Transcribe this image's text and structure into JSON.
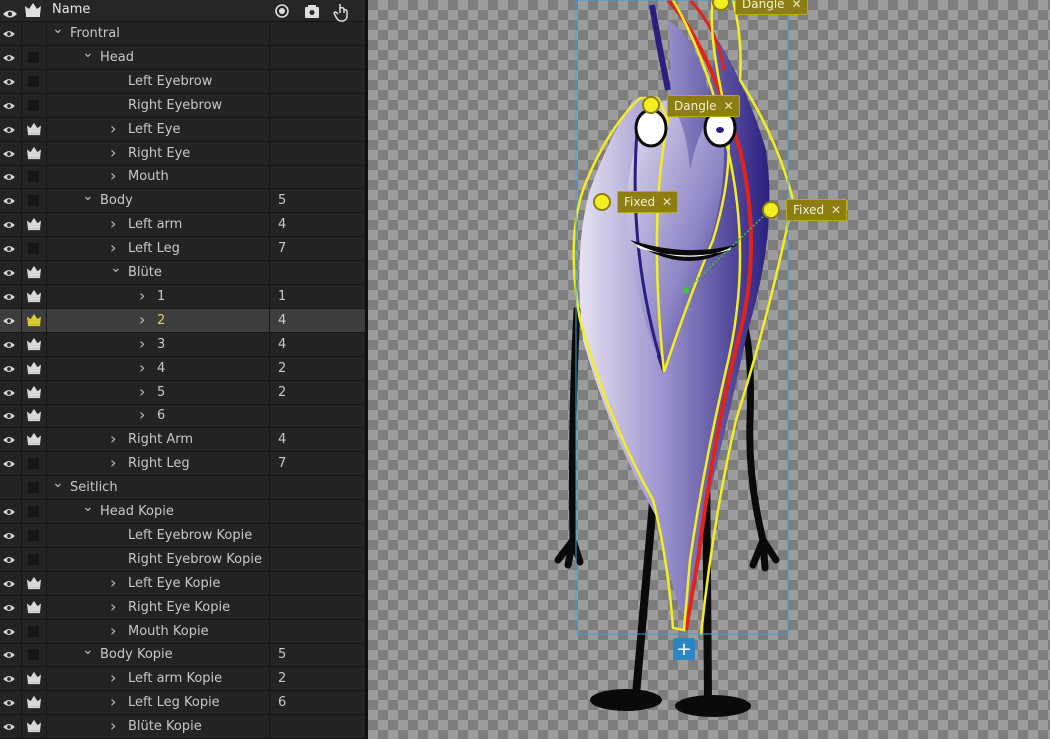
{
  "header": {
    "name_label": "Name",
    "eye_icon": "eye-icon",
    "crown_icon": "crown-icon",
    "record_icon": "record-icon",
    "camera_icon": "camera-icon",
    "hand_icon": "hand-pointer-icon"
  },
  "rows": [
    {
      "label": "Frontral",
      "depth": 0,
      "chevron": "down",
      "eye": true,
      "crown": "none",
      "num": ""
    },
    {
      "label": "Head",
      "depth": 1,
      "chevron": "down",
      "eye": true,
      "crown": "box",
      "num": ""
    },
    {
      "label": "Left Eyebrow",
      "depth": 2,
      "chevron": "",
      "eye": true,
      "crown": "box",
      "num": ""
    },
    {
      "label": "Right Eyebrow",
      "depth": 2,
      "chevron": "",
      "eye": true,
      "crown": "box",
      "num": ""
    },
    {
      "label": "Left Eye",
      "depth": 2,
      "chevron": "right",
      "eye": true,
      "crown": "crown",
      "num": ""
    },
    {
      "label": "Right Eye",
      "depth": 2,
      "chevron": "right",
      "eye": true,
      "crown": "crown",
      "num": ""
    },
    {
      "label": "Mouth",
      "depth": 2,
      "chevron": "right",
      "eye": true,
      "crown": "box",
      "num": ""
    },
    {
      "label": "Body",
      "depth": 1,
      "chevron": "down",
      "eye": true,
      "crown": "box",
      "num": "5"
    },
    {
      "label": "Left arm",
      "depth": 2,
      "chevron": "right",
      "eye": true,
      "crown": "crown",
      "num": "4"
    },
    {
      "label": "Left Leg",
      "depth": 2,
      "chevron": "right",
      "eye": true,
      "crown": "box",
      "num": "7"
    },
    {
      "label": "Blüte",
      "depth": 2,
      "chevron": "down",
      "eye": true,
      "crown": "crown",
      "num": ""
    },
    {
      "label": "1",
      "depth": 3,
      "chevron": "right",
      "eye": true,
      "crown": "crown",
      "num": "1"
    },
    {
      "label": "2",
      "depth": 3,
      "chevron": "right",
      "eye": true,
      "crown": "crown-gold",
      "num": "4",
      "selected": true
    },
    {
      "label": "3",
      "depth": 3,
      "chevron": "right",
      "eye": true,
      "crown": "crown",
      "num": "4"
    },
    {
      "label": "4",
      "depth": 3,
      "chevron": "right",
      "eye": true,
      "crown": "crown",
      "num": "2"
    },
    {
      "label": "5",
      "depth": 3,
      "chevron": "right",
      "eye": true,
      "crown": "crown",
      "num": "2"
    },
    {
      "label": "6",
      "depth": 3,
      "chevron": "right",
      "eye": true,
      "crown": "crown",
      "num": ""
    },
    {
      "label": "Right Arm",
      "depth": 2,
      "chevron": "right",
      "eye": true,
      "crown": "crown",
      "num": "4"
    },
    {
      "label": "Right Leg",
      "depth": 2,
      "chevron": "right",
      "eye": true,
      "crown": "box",
      "num": "7"
    },
    {
      "label": "Seitlich",
      "depth": 0,
      "chevron": "down",
      "eye": false,
      "crown": "box",
      "num": ""
    },
    {
      "label": "Head Kopie",
      "depth": 1,
      "chevron": "down",
      "eye": true,
      "crown": "box",
      "num": ""
    },
    {
      "label": "Left Eyebrow Kopie",
      "depth": 2,
      "chevron": "",
      "eye": true,
      "crown": "box",
      "num": ""
    },
    {
      "label": "Right Eyebrow Kopie",
      "depth": 2,
      "chevron": "",
      "eye": true,
      "crown": "box",
      "num": ""
    },
    {
      "label": "Left Eye Kopie",
      "depth": 2,
      "chevron": "right",
      "eye": true,
      "crown": "crown",
      "num": ""
    },
    {
      "label": "Right Eye Kopie",
      "depth": 2,
      "chevron": "right",
      "eye": true,
      "crown": "crown",
      "num": ""
    },
    {
      "label": "Mouth Kopie",
      "depth": 2,
      "chevron": "right",
      "eye": true,
      "crown": "box",
      "num": ""
    },
    {
      "label": "Body Kopie",
      "depth": 1,
      "chevron": "down",
      "eye": true,
      "crown": "box",
      "num": "5"
    },
    {
      "label": "Left arm Kopie",
      "depth": 2,
      "chevron": "right",
      "eye": true,
      "crown": "crown",
      "num": "2"
    },
    {
      "label": "Left Leg Kopie",
      "depth": 2,
      "chevron": "right",
      "eye": true,
      "crown": "crown",
      "num": "6"
    },
    {
      "label": "Blüte Kopie",
      "depth": 2,
      "chevron": "right",
      "eye": true,
      "crown": "crown",
      "num": ""
    }
  ],
  "canvas": {
    "handles": [
      {
        "label": "Dangle",
        "behavior": "dangle",
        "id": "dangle-top"
      },
      {
        "label": "Dangle",
        "behavior": "dangle",
        "id": "dangle-head"
      },
      {
        "label": "Fixed",
        "behavior": "fixed",
        "id": "fixed-left"
      },
      {
        "label": "Fixed",
        "behavior": "fixed",
        "id": "fixed-right"
      }
    ],
    "handle_close_glyph": "✕",
    "add_button_glyph": "+",
    "colors": {
      "tag_bg": "#8c7e12",
      "selection_box": "#3aa0d8",
      "outline_yellow": "#f2ee22",
      "outline_red": "#e0241c",
      "body_purple": "#3a2f8c"
    }
  }
}
